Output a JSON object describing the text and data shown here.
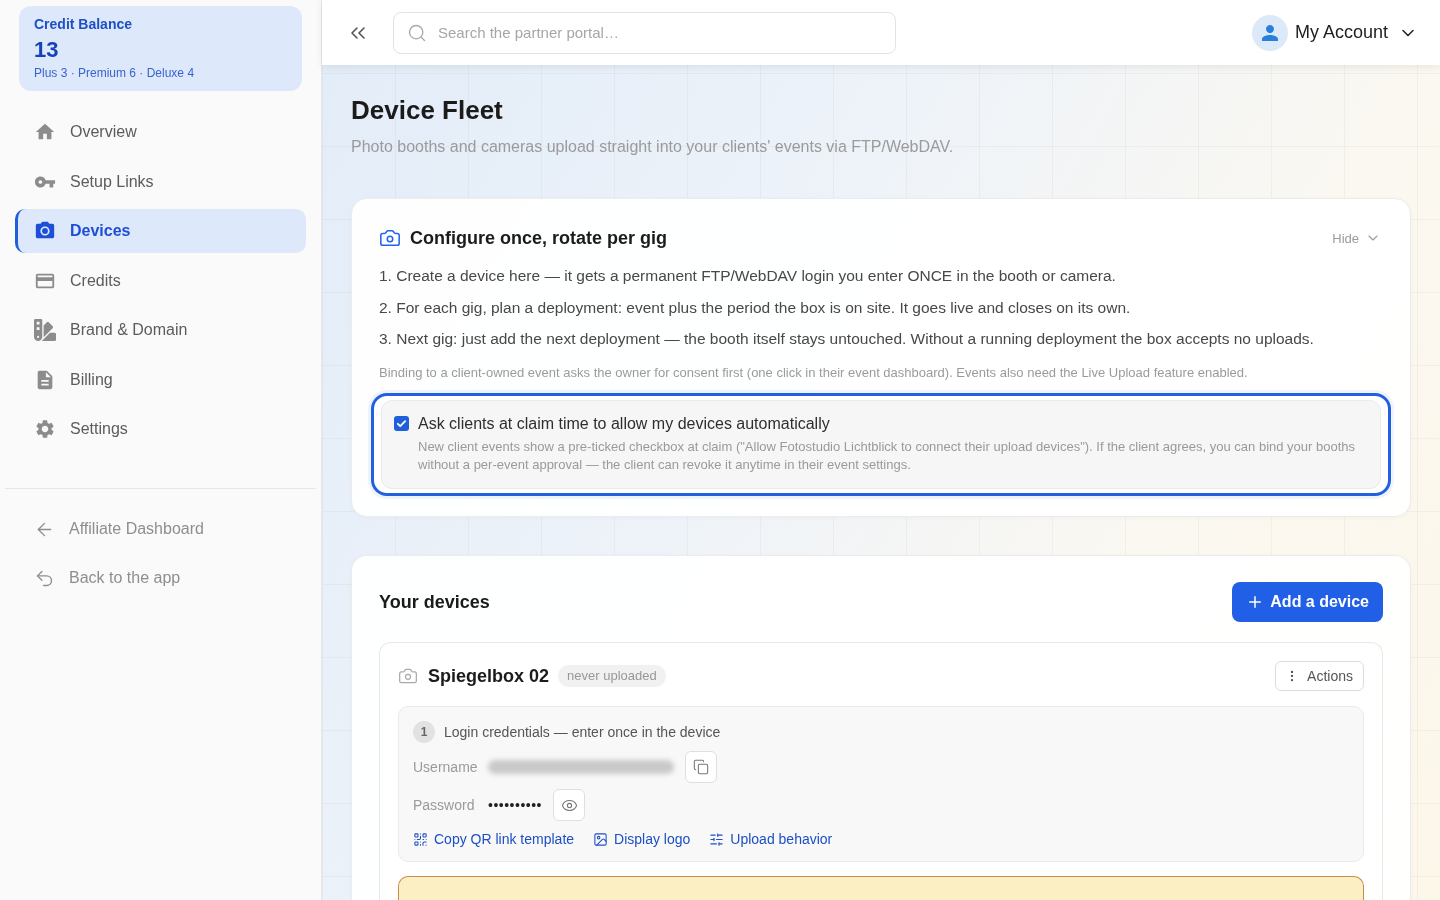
{
  "sidebar": {
    "credit_balance": {
      "label": "Credit Balance",
      "value": "13",
      "breakdown": "Plus 3 · Premium 6 · Deluxe 4"
    },
    "nav_items": [
      {
        "label": "Overview",
        "selected": false
      },
      {
        "label": "Setup Links",
        "selected": false
      },
      {
        "label": "Devices",
        "selected": true
      },
      {
        "label": "Credits",
        "selected": false
      },
      {
        "label": "Brand & Domain",
        "selected": false
      },
      {
        "label": "Billing",
        "selected": false
      },
      {
        "label": "Settings",
        "selected": false
      }
    ],
    "footer_links": [
      {
        "label": "Affiliate Dashboard"
      },
      {
        "label": "Back to the app"
      }
    ]
  },
  "header": {
    "search": {
      "placeholder": "Search the partner portal…"
    },
    "account": {
      "label": "My Account"
    }
  },
  "page": {
    "title": "Device Fleet",
    "subtitle": "Photo booths and cameras upload straight into your clients' events via FTP/WebDAV."
  },
  "info_card": {
    "title": "Configure once, rotate per gig",
    "toggle": "Hide",
    "steps": [
      "1. Create a device here — it gets a permanent FTP/WebDAV login you enter ONCE in the booth or camera.",
      "2. For each gig, plan a deployment: event plus the period the box is on site. It goes live and closes on its own.",
      "3. Next gig: just add the next deployment — the booth itself stays untouched. Without a running deployment the box accepts no uploads."
    ],
    "note": "Binding to a client-owned event asks the owner for consent first (one click in their event dashboard). Events also need the Live Upload feature enabled.",
    "consent_option": {
      "label": "Ask clients at claim time to allow my devices automatically",
      "description": "New client events show a pre-ticked checkbox at claim (\"Allow Fotostudio Lichtblick to connect their upload devices\"). If the client agrees, you can bind your booths without a per-event approval — the client can revoke it anytime in their event settings.",
      "checked": true,
      "focused": true
    }
  },
  "devices_section": {
    "title": "Your devices",
    "add_button": "Add a device",
    "devices": [
      {
        "name": "Spiegelbox 02",
        "status": "never uploaded",
        "actions_button": "Actions",
        "credentials": {
          "step": "1",
          "title": "Login credentials — enter once in the device",
          "username_label": "Username",
          "password_label": "Password",
          "password_value": "••••••••••"
        },
        "links": [
          "Copy QR link template",
          "Display logo",
          "Upload behavior"
        ]
      }
    ]
  }
}
